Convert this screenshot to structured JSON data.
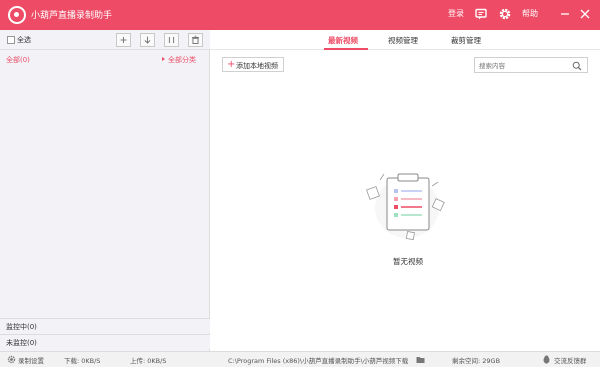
{
  "app": {
    "title": "小葫芦直播录制助手",
    "accent_color": "#ee4c66"
  },
  "titlebar": {
    "login_label": "登录",
    "message_icon": "message-icon",
    "settings_icon": "gear-icon",
    "help_label": "帮助",
    "minimize_icon": "minimize-icon",
    "close_icon": "close-icon"
  },
  "left": {
    "select_all_label": "全选",
    "toolbar_icons": [
      "add-icon",
      "download-icon",
      "columns-icon",
      "delete-icon"
    ],
    "filter_all": "全部(0)",
    "filter_category": "全部分类",
    "monitoring": "监控中(0)",
    "not_monitoring": "未监控(0)"
  },
  "tabs": [
    {
      "label": "最新视频",
      "active": true
    },
    {
      "label": "视频管理",
      "active": false
    },
    {
      "label": "裁剪管理",
      "active": false
    }
  ],
  "main": {
    "add_local_video": "添加本地视频",
    "search_placeholder": "搜索内容",
    "empty_text": "暂无视频"
  },
  "statusbar": {
    "settings_label": "录制设置",
    "download_label": "下载: 0KB/S",
    "upload_label": "上传: 0KB/S",
    "path": "C:\\Program Files (x86)\\小葫芦直播录制助手\\小葫芦视频下载",
    "free_space": "剩余空间: 29GB",
    "feedback": "交流反馈群"
  }
}
